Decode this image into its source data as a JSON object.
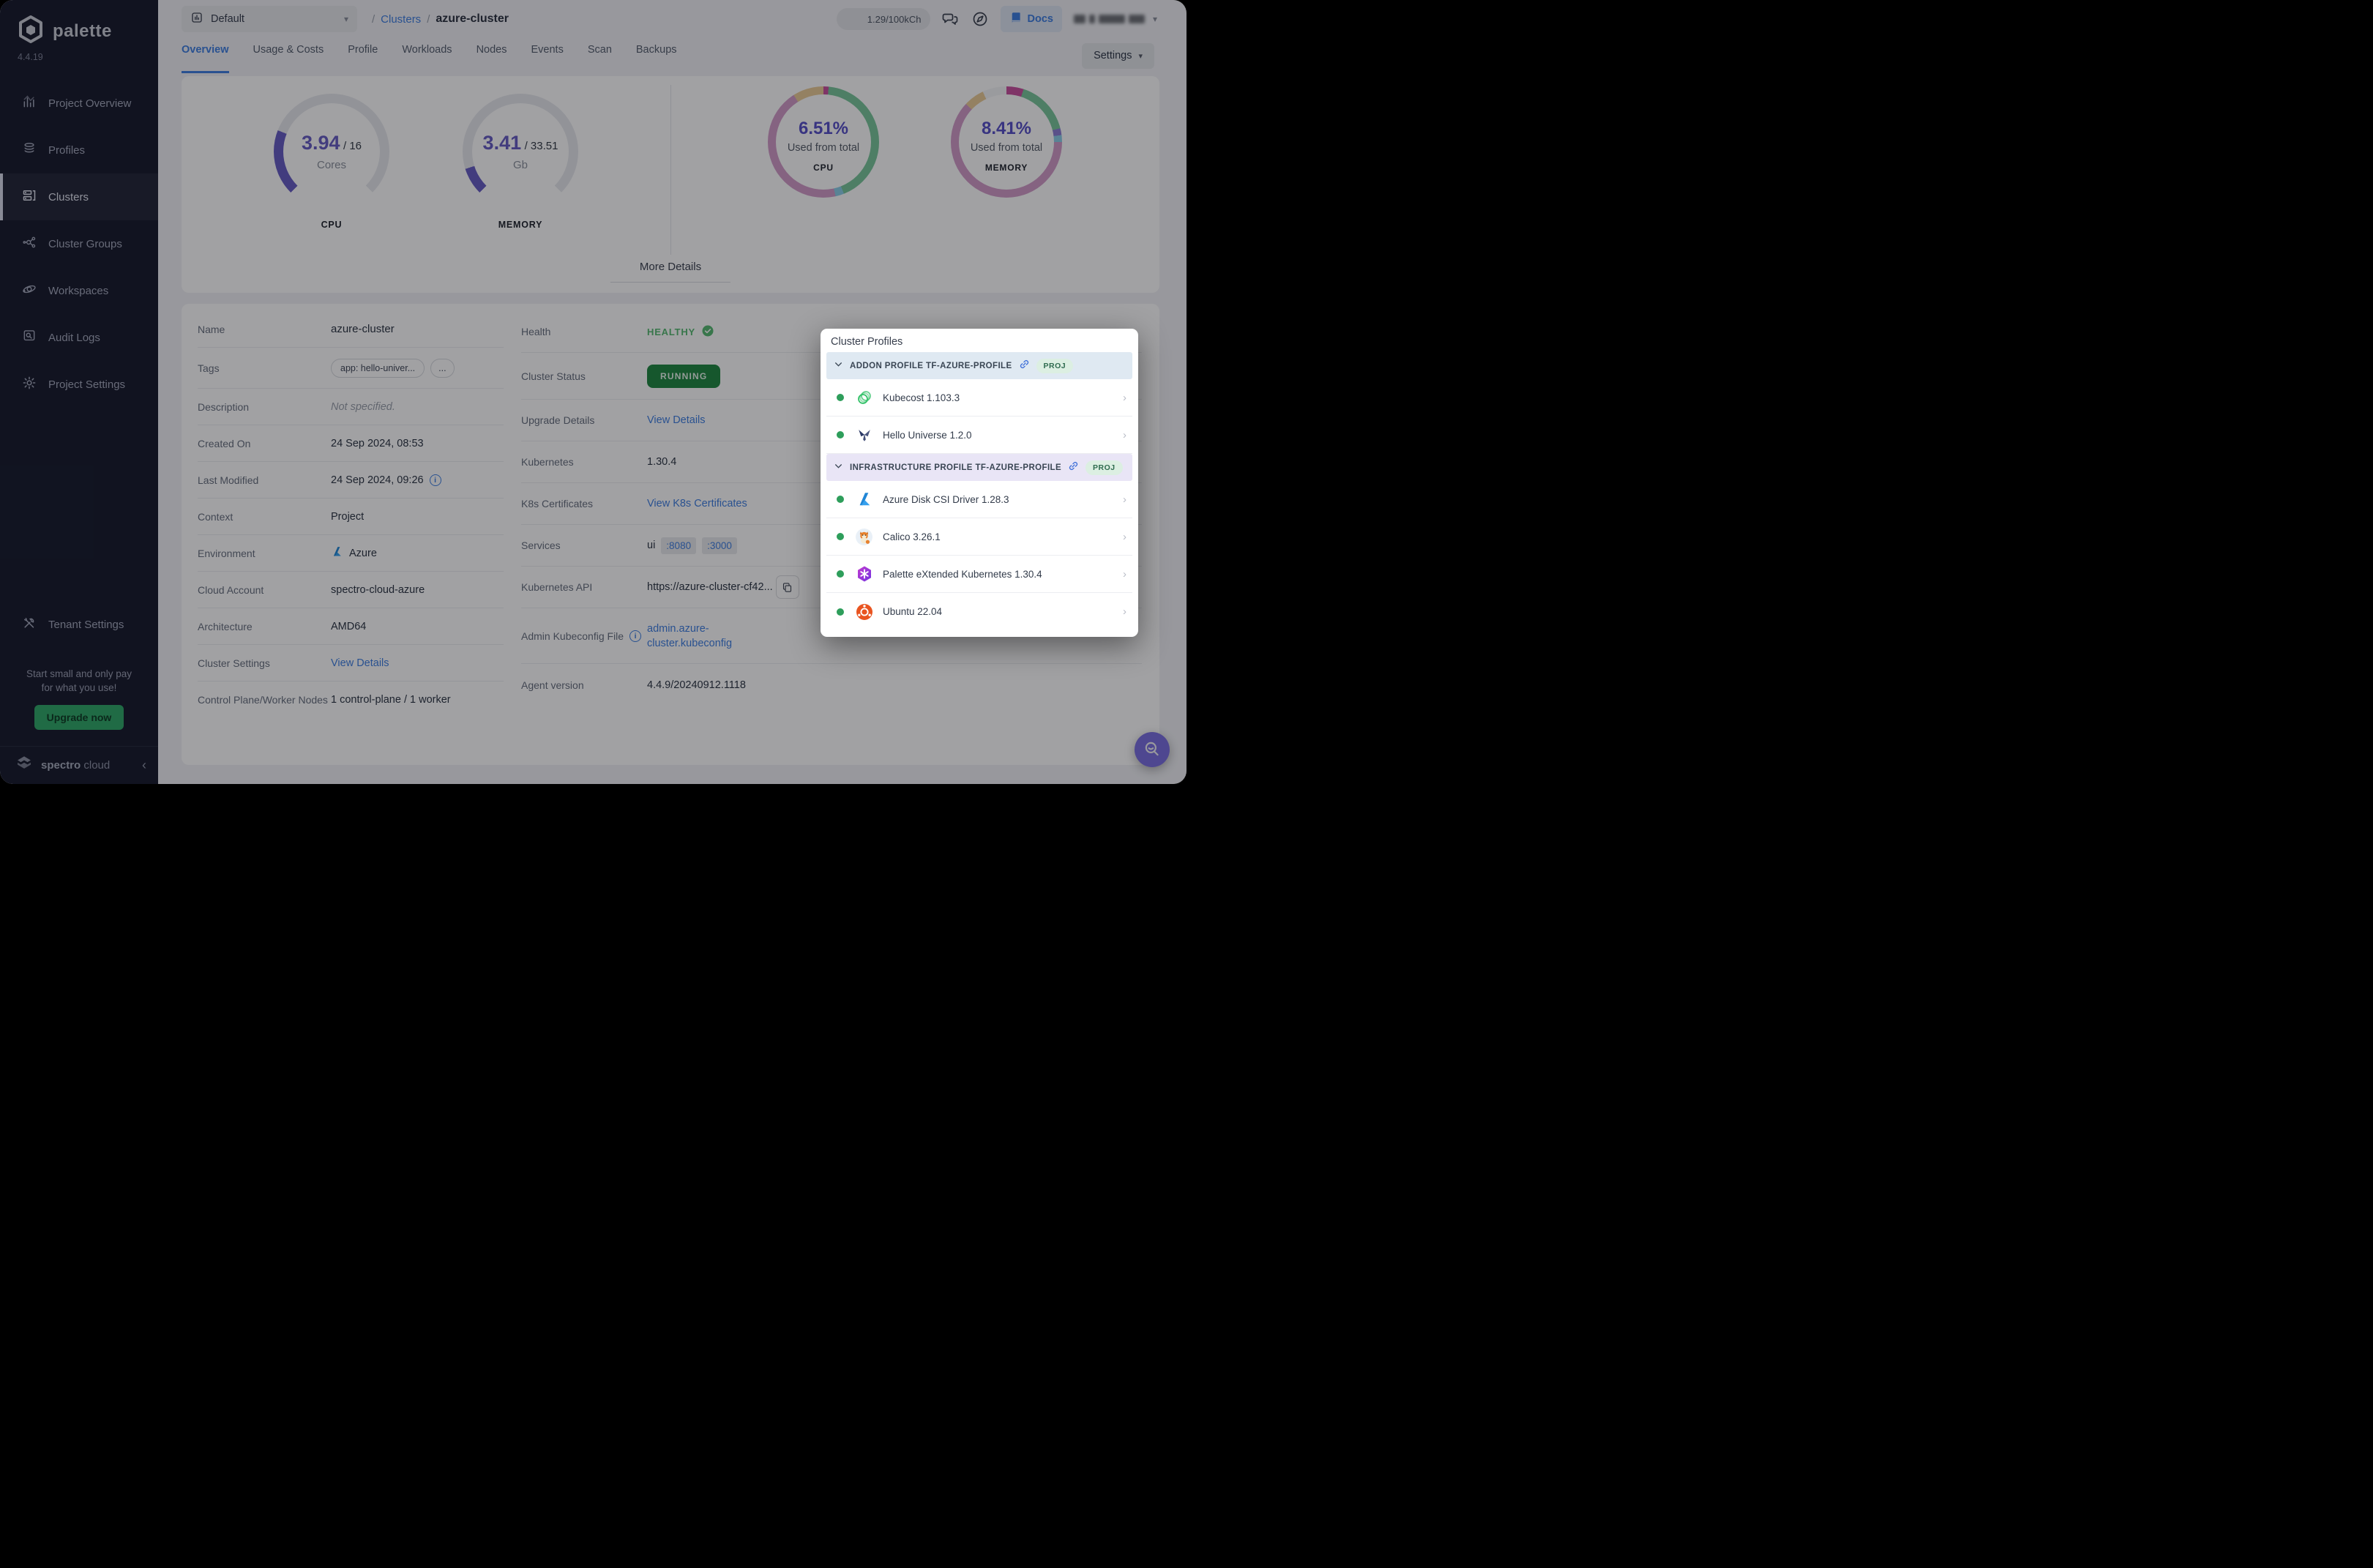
{
  "app": {
    "brand": "palette",
    "version": "4.4.19",
    "footer_brand_bold": "spectro",
    "footer_brand_light": "cloud"
  },
  "colors": {
    "accent_blue": "#3E7EE0",
    "healthy_green": "#56BA71",
    "running_badge_bg": "#1F8841",
    "upgrade_green": "#2FA968",
    "gauge_fill": "#665CC4",
    "gauge_track": "#E7E8EE",
    "percent_purple": "#564FC8",
    "fab_purple": "#7A6EE0"
  },
  "sidebar": {
    "items": [
      {
        "label": "Project Overview"
      },
      {
        "label": "Profiles"
      },
      {
        "label": "Clusters"
      },
      {
        "label": "Cluster Groups"
      },
      {
        "label": "Workspaces"
      },
      {
        "label": "Audit Logs"
      },
      {
        "label": "Project Settings"
      }
    ],
    "active_item": "Clusters",
    "tenant_label": "Tenant Settings",
    "promo_line1": "Start small and only pay",
    "promo_line2": "for what you use!",
    "upgrade_label": "Upgrade now"
  },
  "topbar": {
    "selector_label": "Default",
    "sep": "/",
    "crumb_section": "Clusters",
    "crumb_current": "azure-cluster",
    "credits": "1.29/100kCh",
    "docs_label": "Docs"
  },
  "tabs": {
    "items": [
      {
        "label": "Overview"
      },
      {
        "label": "Usage & Costs"
      },
      {
        "label": "Profile"
      },
      {
        "label": "Workloads"
      },
      {
        "label": "Nodes"
      },
      {
        "label": "Events"
      },
      {
        "label": "Scan"
      },
      {
        "label": "Backups"
      }
    ],
    "active": "Overview",
    "settings_label": "Settings"
  },
  "metrics": {
    "cpu_gauge": {
      "value": "3.94",
      "total": "/ 16",
      "unit": "Cores",
      "caption": "CPU",
      "used": 3.94,
      "max": 16
    },
    "memory_gauge": {
      "value": "3.41",
      "total": "/ 33.51",
      "unit": "Gb",
      "caption": "MEMORY",
      "used": 3.41,
      "max": 33.51
    },
    "cpu_donut": {
      "percent": "6.51%",
      "subtitle": "Used from total",
      "caption": "CPU",
      "segments": [
        {
          "color": "#C9509E",
          "pct": 1.5
        },
        {
          "color": "#79C79B",
          "pct": 42.5
        },
        {
          "color": "#8CCFE8",
          "pct": 2.5
        },
        {
          "color": "#D29BC8",
          "pct": 44.5
        },
        {
          "color": "#EBCB96",
          "pct": 9
        }
      ]
    },
    "memory_donut": {
      "percent": "8.41%",
      "subtitle": "Used from total",
      "caption": "MEMORY",
      "segments": [
        {
          "color": "#C9509E",
          "pct": 5
        },
        {
          "color": "#79C79B",
          "pct": 16
        },
        {
          "color": "#8D7FD6",
          "pct": 2
        },
        {
          "color": "#8CCFE8",
          "pct": 2
        },
        {
          "color": "#D29BC8",
          "pct": 62
        },
        {
          "color": "#EBCB96",
          "pct": 6
        },
        {
          "color": "#F4F5F7",
          "pct": 7
        }
      ]
    },
    "more_details_label": "More Details"
  },
  "details": {
    "left": {
      "name": {
        "label": "Name",
        "value": "azure-cluster"
      },
      "tags": {
        "label": "Tags",
        "tag": "app: hello-univer...",
        "more": "..."
      },
      "description": {
        "label": "Description",
        "value": "Not specified."
      },
      "created": {
        "label": "Created On",
        "value": "24 Sep 2024, 08:53"
      },
      "modified": {
        "label": "Last Modified",
        "value": "24 Sep 2024, 09:26"
      },
      "context": {
        "label": "Context",
        "value": "Project"
      },
      "environment": {
        "label": "Environment",
        "value": "Azure"
      },
      "cloud_account": {
        "label": "Cloud Account",
        "value": "spectro-cloud-azure"
      },
      "architecture": {
        "label": "Architecture",
        "value": "AMD64"
      },
      "cluster_settings": {
        "label": "Cluster Settings",
        "link": "View Details"
      },
      "nodes": {
        "label": "Control Plane/Worker Nodes",
        "value": "1 control-plane / 1 worker"
      }
    },
    "right": {
      "health": {
        "label": "Health",
        "value": "HEALTHY"
      },
      "status": {
        "label": "Cluster Status",
        "value": "RUNNING"
      },
      "upgrade": {
        "label": "Upgrade Details",
        "link": "View Details"
      },
      "kubernetes": {
        "label": "Kubernetes",
        "value": "1.30.4"
      },
      "certs": {
        "label": "K8s Certificates",
        "link": "View K8s Certificates"
      },
      "services": {
        "label": "Services",
        "prefix": "ui",
        "ports": [
          ":8080",
          ":3000"
        ]
      },
      "api": {
        "label": "Kubernetes API",
        "value": "https://azure-cluster-cf42..."
      },
      "kubeconfig": {
        "label": "Admin Kubeconfig File",
        "link": "admin.azure-cluster.kubeconfig"
      },
      "agent": {
        "label": "Agent version",
        "value": "4.4.9/20240912.1118"
      }
    }
  },
  "cluster_profiles": {
    "title": "Cluster Profiles",
    "badge": "PROJ",
    "addon_header": "ADDON PROFILE TF-AZURE-PROFILE",
    "addon_items": [
      {
        "name": "Kubecost 1.103.3"
      },
      {
        "name": "Hello Universe 1.2.0"
      }
    ],
    "infra_header": "INFRASTRUCTURE PROFILE TF-AZURE-PROFILE",
    "infra_items": [
      {
        "name": "Azure Disk CSI Driver 1.28.3"
      },
      {
        "name": "Calico 3.26.1"
      },
      {
        "name": "Palette eXtended Kubernetes 1.30.4"
      },
      {
        "name": "Ubuntu 22.04"
      }
    ]
  }
}
